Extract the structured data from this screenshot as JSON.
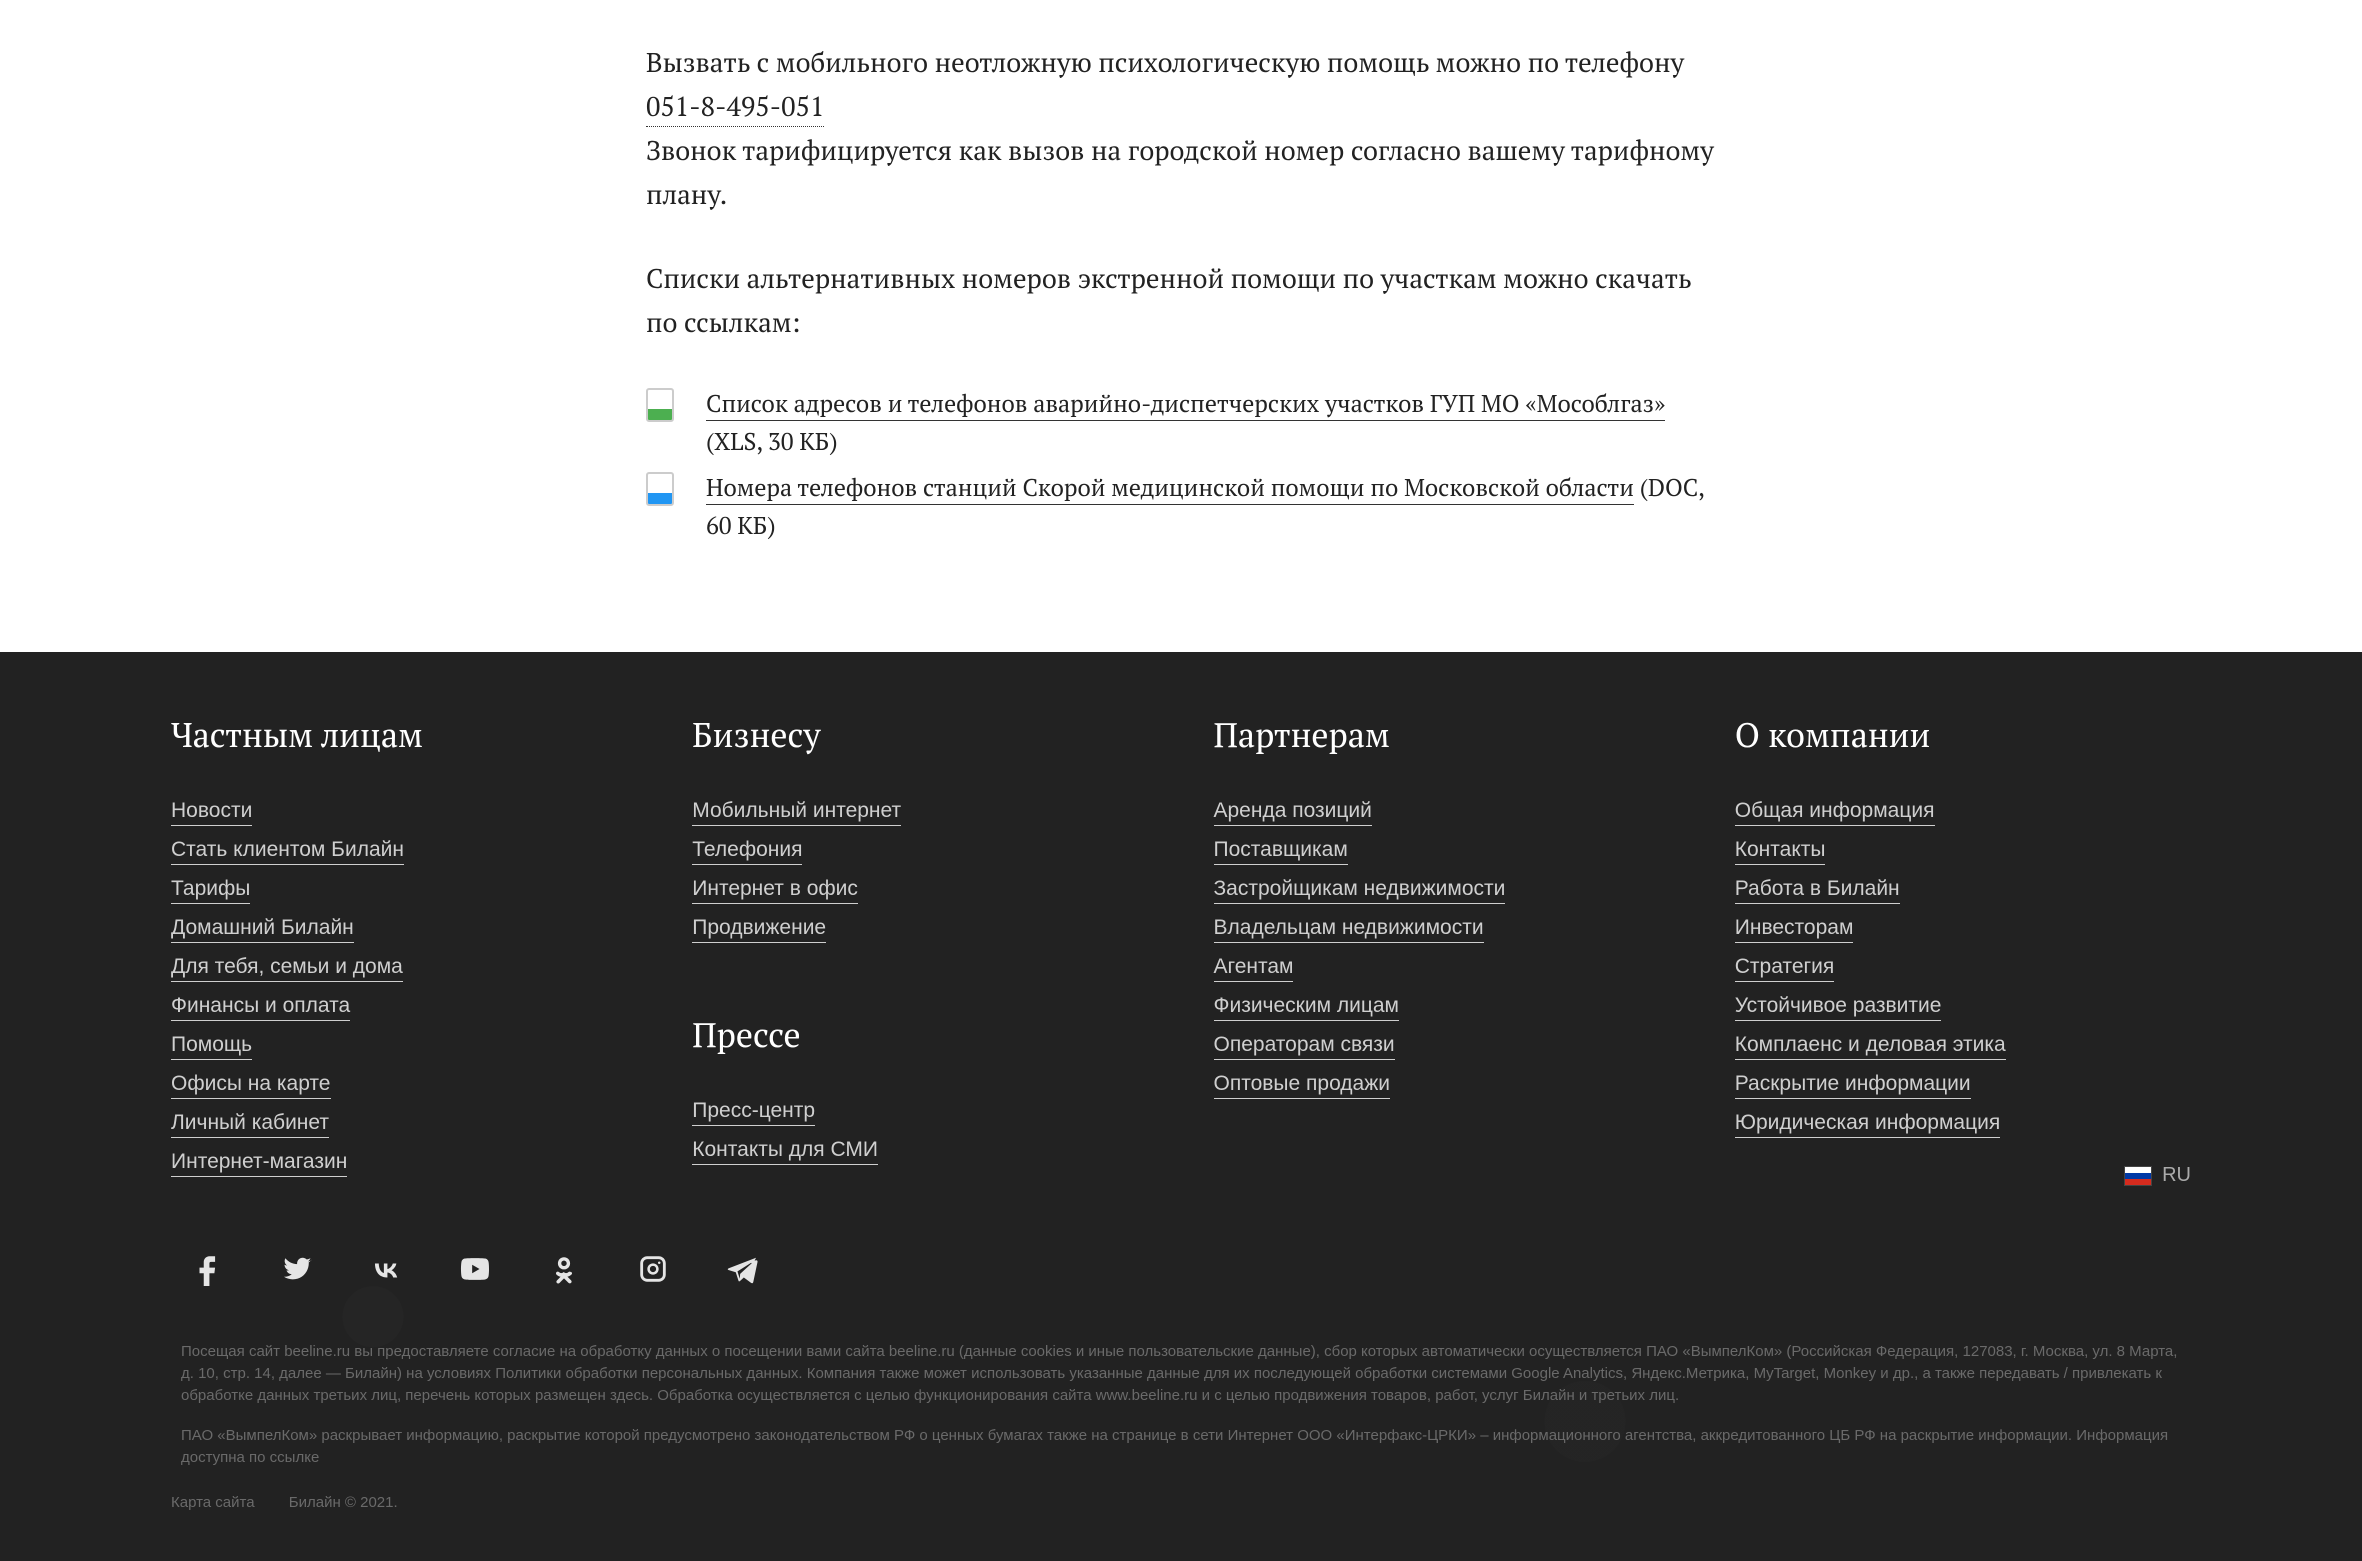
{
  "article": {
    "p1_prefix": "Вызвать с мобильного неотложную психологическую помощь можно по телефону ",
    "phone": "051-8-495-051",
    "p1_suffix": "Звонок тарифицируется как вызов на городской номер согласно вашему тарифному плану.",
    "p2": "Списки альтернативных номеров экстренной помощи по участкам можно скачать по ссылкам:",
    "downloads": [
      {
        "type": "xls",
        "title": "Список адресов и телефонов аварийно-диспетчерских участков ГУП МО «Мособлгаз»",
        "meta": "(XLS, 30 КБ)"
      },
      {
        "type": "doc",
        "title": "Номера телефонов станций Скорой медицинской помощи по Московской области",
        "meta": "(DOC, 60 КБ)"
      }
    ]
  },
  "footer": {
    "cols": [
      {
        "heading": "Частным лицам",
        "links": [
          "Новости",
          "Стать клиентом Билайн",
          "Тарифы",
          "Домашний Билайн",
          "Для тебя, семьи и дома",
          "Финансы и оплата",
          "Помощь",
          "Офисы на карте",
          "Личный кабинет",
          "Интернет-магазин"
        ]
      },
      {
        "heading": "Бизнесу",
        "links": [
          "Мобильный интернет",
          "Телефония",
          "Интернет в офис",
          "Продвижение"
        ],
        "sub": {
          "heading": "Прессе",
          "links": [
            "Пресс-центр",
            "Контакты для СМИ"
          ]
        }
      },
      {
        "heading": "Партнерам",
        "links": [
          "Аренда позиций",
          "Поставщикам",
          "Застройщикам недвижимости",
          "Владельцам недвижимости",
          "Агентам",
          "Физическим лицам",
          "Операторам связи",
          "Оптовые продажи"
        ]
      },
      {
        "heading": "О компании",
        "links": [
          "Общая информация",
          "Контакты",
          "Работа в Билайн",
          "Инвесторам",
          "Стратегия",
          "Устойчивое развитие",
          "Комплаенс и деловая этика",
          "Раскрытие информации",
          "Юридическая информация"
        ]
      }
    ],
    "lang": "RU",
    "social": [
      "facebook",
      "twitter",
      "vk",
      "youtube",
      "ok",
      "instagram",
      "telegram"
    ],
    "legal": [
      "Посещая сайт beeline.ru вы предоставляете согласие на обработку данных о посещении вами сайта beeline.ru (данные cookies и иные пользовательские данные), сбор которых автоматически осуществляется ПАО «ВымпелКом» (Российская Федерация, 127083, г. Москва, ул. 8 Марта, д. 10, стр. 14, далее — Билайн) на условиях Политики обработки персональных данных. Компания также может использовать указанные данные для их последующей обработки системами Google Analytics, Яндекс.Метрика, MyTarget, Monkey и др., а также передавать / привлекать к обработке данных третьих лиц, перечень которых размещен здесь. Обработка осуществляется с целью функционирования сайта www.beeline.ru и с целью продвижения товаров, работ, услуг Билайн и третьих лиц.",
      "ПАО «ВымпелКом» раскрывает информацию, раскрытие которой предусмотрено законодательством РФ о ценных бумагах также на странице в сети Интернет ООО «Интерфакс-ЦРКИ» – информационного агентства, аккредитованного ЦБ РФ на раскрытие информации. Информация доступна по ссылке"
    ],
    "meta": {
      "sitemap": "Карта сайта",
      "copyright": "Билайн © 2021."
    }
  }
}
